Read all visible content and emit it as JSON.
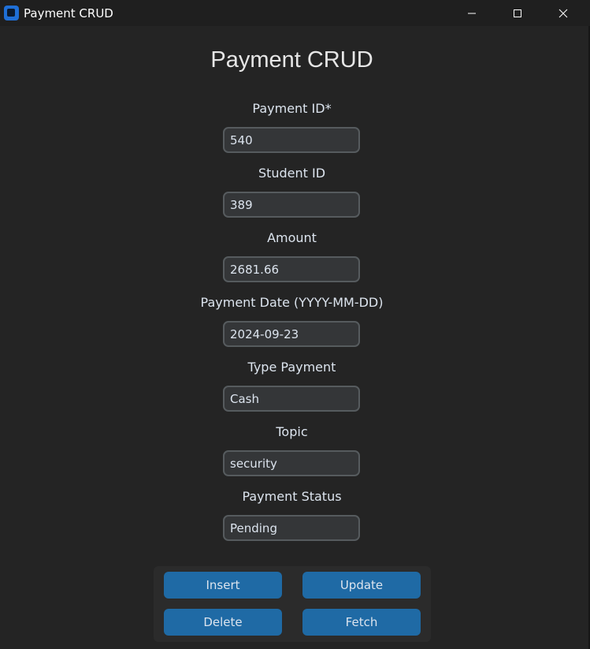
{
  "window": {
    "title": "Payment CRUD"
  },
  "page": {
    "heading": "Payment CRUD"
  },
  "fields": [
    {
      "label": "Payment ID*",
      "value": "540"
    },
    {
      "label": "Student ID",
      "value": "389"
    },
    {
      "label": "Amount",
      "value": "2681.66"
    },
    {
      "label": "Payment Date (YYYY-MM-DD)",
      "value": "2024-09-23"
    },
    {
      "label": "Type Payment",
      "value": "Cash"
    },
    {
      "label": "Topic",
      "value": "security"
    },
    {
      "label": "Payment Status",
      "value": "Pending"
    }
  ],
  "buttons": {
    "insert": "Insert",
    "update": "Update",
    "delete": "Delete",
    "fetch": "Fetch"
  },
  "colors": {
    "background": "#242424",
    "input_background": "#343638",
    "input_border": "#565b5e",
    "button": "#1f6aa5",
    "text": "#dce4ee"
  },
  "icons": {
    "app": "app-icon",
    "minimize": "minimize-icon",
    "maximize": "maximize-icon",
    "close": "close-icon"
  }
}
